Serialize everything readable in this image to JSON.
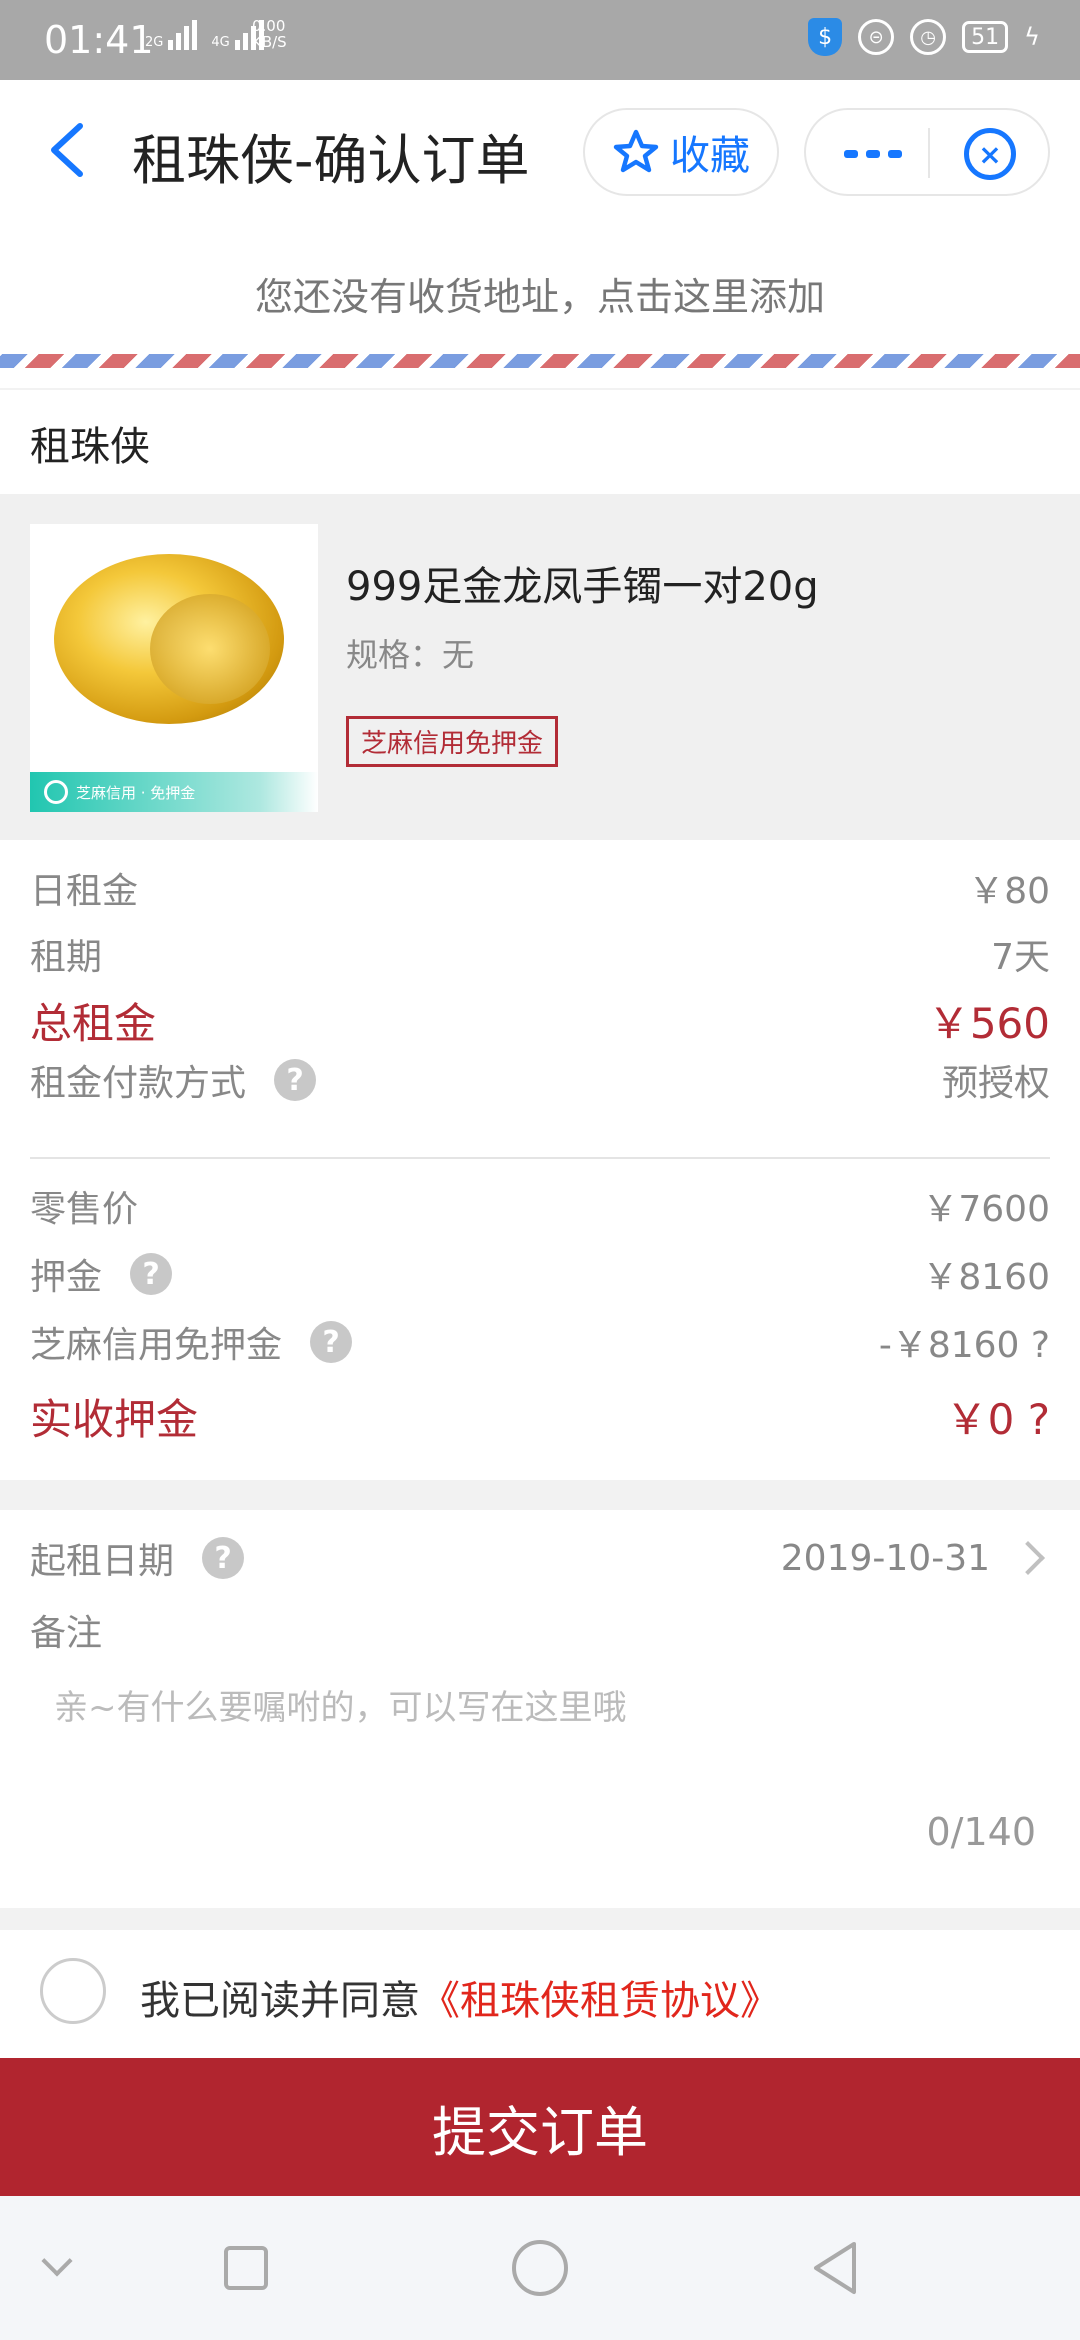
{
  "status_bar": {
    "time": "01:41",
    "net1": "2G",
    "net2": "4G",
    "speed_value": "0.00",
    "speed_unit": "KB/S",
    "battery": "51"
  },
  "header": {
    "title": "租珠侠-确认订单",
    "favorite_label": "收藏",
    "accent_color": "#1677ff"
  },
  "address": {
    "prompt": "您还没有收货地址，点击这里添加"
  },
  "shop": {
    "name": "租珠侠"
  },
  "product": {
    "name": "999足金龙凤手镯一对20g",
    "spec": "规格：无",
    "tag": "芝麻信用免押金",
    "thumb_caption": "芝麻信用 · 免押金"
  },
  "pricing": {
    "daily_rent_label": "日租金",
    "daily_rent_value": "￥80",
    "term_label": "租期",
    "term_value": "7天",
    "total_rent_label": "总租金",
    "total_rent_value": "￥560",
    "payment_label": "租金付款方式",
    "payment_value": "预授权",
    "retail_label": "零售价",
    "retail_value": "￥7600",
    "deposit_label": "押金",
    "deposit_value": "￥8160",
    "waiver_label": "芝麻信用免押金",
    "waiver_value": "-￥8160 ?",
    "actual_deposit_label": "实收押金",
    "actual_deposit_value": "￥0 ?",
    "highlight_color": "#b22c36"
  },
  "details": {
    "start_date_label": "起租日期",
    "start_date_value": "2019-10-31",
    "note_label": "备注",
    "note_placeholder": "亲~有什么要嘱咐的，可以写在这里哦",
    "note_counter": "0/140"
  },
  "agreement": {
    "text": "我已阅读并同意",
    "link": "《租珠侠租赁协议》"
  },
  "submit": {
    "label": "提交订单",
    "color": "#b1252f"
  }
}
